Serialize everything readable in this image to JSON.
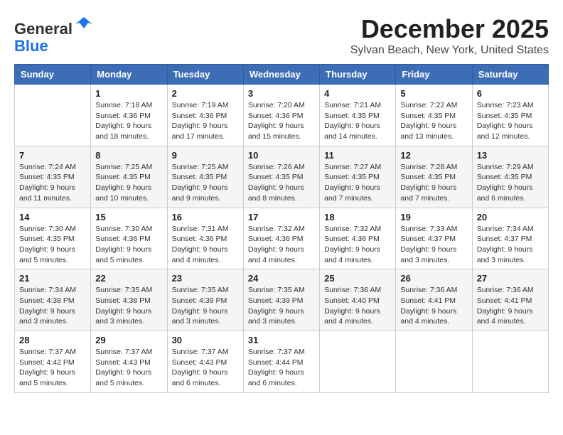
{
  "logo": {
    "general": "General",
    "blue": "Blue"
  },
  "header": {
    "month": "December 2025",
    "location": "Sylvan Beach, New York, United States"
  },
  "weekdays": [
    "Sunday",
    "Monday",
    "Tuesday",
    "Wednesday",
    "Thursday",
    "Friday",
    "Saturday"
  ],
  "weeks": [
    [
      {
        "day": "",
        "info": ""
      },
      {
        "day": "1",
        "info": "Sunrise: 7:18 AM\nSunset: 4:36 PM\nDaylight: 9 hours\nand 18 minutes."
      },
      {
        "day": "2",
        "info": "Sunrise: 7:19 AM\nSunset: 4:36 PM\nDaylight: 9 hours\nand 17 minutes."
      },
      {
        "day": "3",
        "info": "Sunrise: 7:20 AM\nSunset: 4:36 PM\nDaylight: 9 hours\nand 15 minutes."
      },
      {
        "day": "4",
        "info": "Sunrise: 7:21 AM\nSunset: 4:35 PM\nDaylight: 9 hours\nand 14 minutes."
      },
      {
        "day": "5",
        "info": "Sunrise: 7:22 AM\nSunset: 4:35 PM\nDaylight: 9 hours\nand 13 minutes."
      },
      {
        "day": "6",
        "info": "Sunrise: 7:23 AM\nSunset: 4:35 PM\nDaylight: 9 hours\nand 12 minutes."
      }
    ],
    [
      {
        "day": "7",
        "info": "Sunrise: 7:24 AM\nSunset: 4:35 PM\nDaylight: 9 hours\nand 11 minutes."
      },
      {
        "day": "8",
        "info": "Sunrise: 7:25 AM\nSunset: 4:35 PM\nDaylight: 9 hours\nand 10 minutes."
      },
      {
        "day": "9",
        "info": "Sunrise: 7:25 AM\nSunset: 4:35 PM\nDaylight: 9 hours\nand 9 minutes."
      },
      {
        "day": "10",
        "info": "Sunrise: 7:26 AM\nSunset: 4:35 PM\nDaylight: 9 hours\nand 8 minutes."
      },
      {
        "day": "11",
        "info": "Sunrise: 7:27 AM\nSunset: 4:35 PM\nDaylight: 9 hours\nand 7 minutes."
      },
      {
        "day": "12",
        "info": "Sunrise: 7:28 AM\nSunset: 4:35 PM\nDaylight: 9 hours\nand 7 minutes."
      },
      {
        "day": "13",
        "info": "Sunrise: 7:29 AM\nSunset: 4:35 PM\nDaylight: 9 hours\nand 6 minutes."
      }
    ],
    [
      {
        "day": "14",
        "info": "Sunrise: 7:30 AM\nSunset: 4:35 PM\nDaylight: 9 hours\nand 5 minutes."
      },
      {
        "day": "15",
        "info": "Sunrise: 7:30 AM\nSunset: 4:36 PM\nDaylight: 9 hours\nand 5 minutes."
      },
      {
        "day": "16",
        "info": "Sunrise: 7:31 AM\nSunset: 4:36 PM\nDaylight: 9 hours\nand 4 minutes."
      },
      {
        "day": "17",
        "info": "Sunrise: 7:32 AM\nSunset: 4:36 PM\nDaylight: 9 hours\nand 4 minutes."
      },
      {
        "day": "18",
        "info": "Sunrise: 7:32 AM\nSunset: 4:36 PM\nDaylight: 9 hours\nand 4 minutes."
      },
      {
        "day": "19",
        "info": "Sunrise: 7:33 AM\nSunset: 4:37 PM\nDaylight: 9 hours\nand 3 minutes."
      },
      {
        "day": "20",
        "info": "Sunrise: 7:34 AM\nSunset: 4:37 PM\nDaylight: 9 hours\nand 3 minutes."
      }
    ],
    [
      {
        "day": "21",
        "info": "Sunrise: 7:34 AM\nSunset: 4:38 PM\nDaylight: 9 hours\nand 3 minutes."
      },
      {
        "day": "22",
        "info": "Sunrise: 7:35 AM\nSunset: 4:38 PM\nDaylight: 9 hours\nand 3 minutes."
      },
      {
        "day": "23",
        "info": "Sunrise: 7:35 AM\nSunset: 4:39 PM\nDaylight: 9 hours\nand 3 minutes."
      },
      {
        "day": "24",
        "info": "Sunrise: 7:35 AM\nSunset: 4:39 PM\nDaylight: 9 hours\nand 3 minutes."
      },
      {
        "day": "25",
        "info": "Sunrise: 7:36 AM\nSunset: 4:40 PM\nDaylight: 9 hours\nand 4 minutes."
      },
      {
        "day": "26",
        "info": "Sunrise: 7:36 AM\nSunset: 4:41 PM\nDaylight: 9 hours\nand 4 minutes."
      },
      {
        "day": "27",
        "info": "Sunrise: 7:36 AM\nSunset: 4:41 PM\nDaylight: 9 hours\nand 4 minutes."
      }
    ],
    [
      {
        "day": "28",
        "info": "Sunrise: 7:37 AM\nSunset: 4:42 PM\nDaylight: 9 hours\nand 5 minutes."
      },
      {
        "day": "29",
        "info": "Sunrise: 7:37 AM\nSunset: 4:43 PM\nDaylight: 9 hours\nand 5 minutes."
      },
      {
        "day": "30",
        "info": "Sunrise: 7:37 AM\nSunset: 4:43 PM\nDaylight: 9 hours\nand 6 minutes."
      },
      {
        "day": "31",
        "info": "Sunrise: 7:37 AM\nSunset: 4:44 PM\nDaylight: 9 hours\nand 6 minutes."
      },
      {
        "day": "",
        "info": ""
      },
      {
        "day": "",
        "info": ""
      },
      {
        "day": "",
        "info": ""
      }
    ]
  ]
}
